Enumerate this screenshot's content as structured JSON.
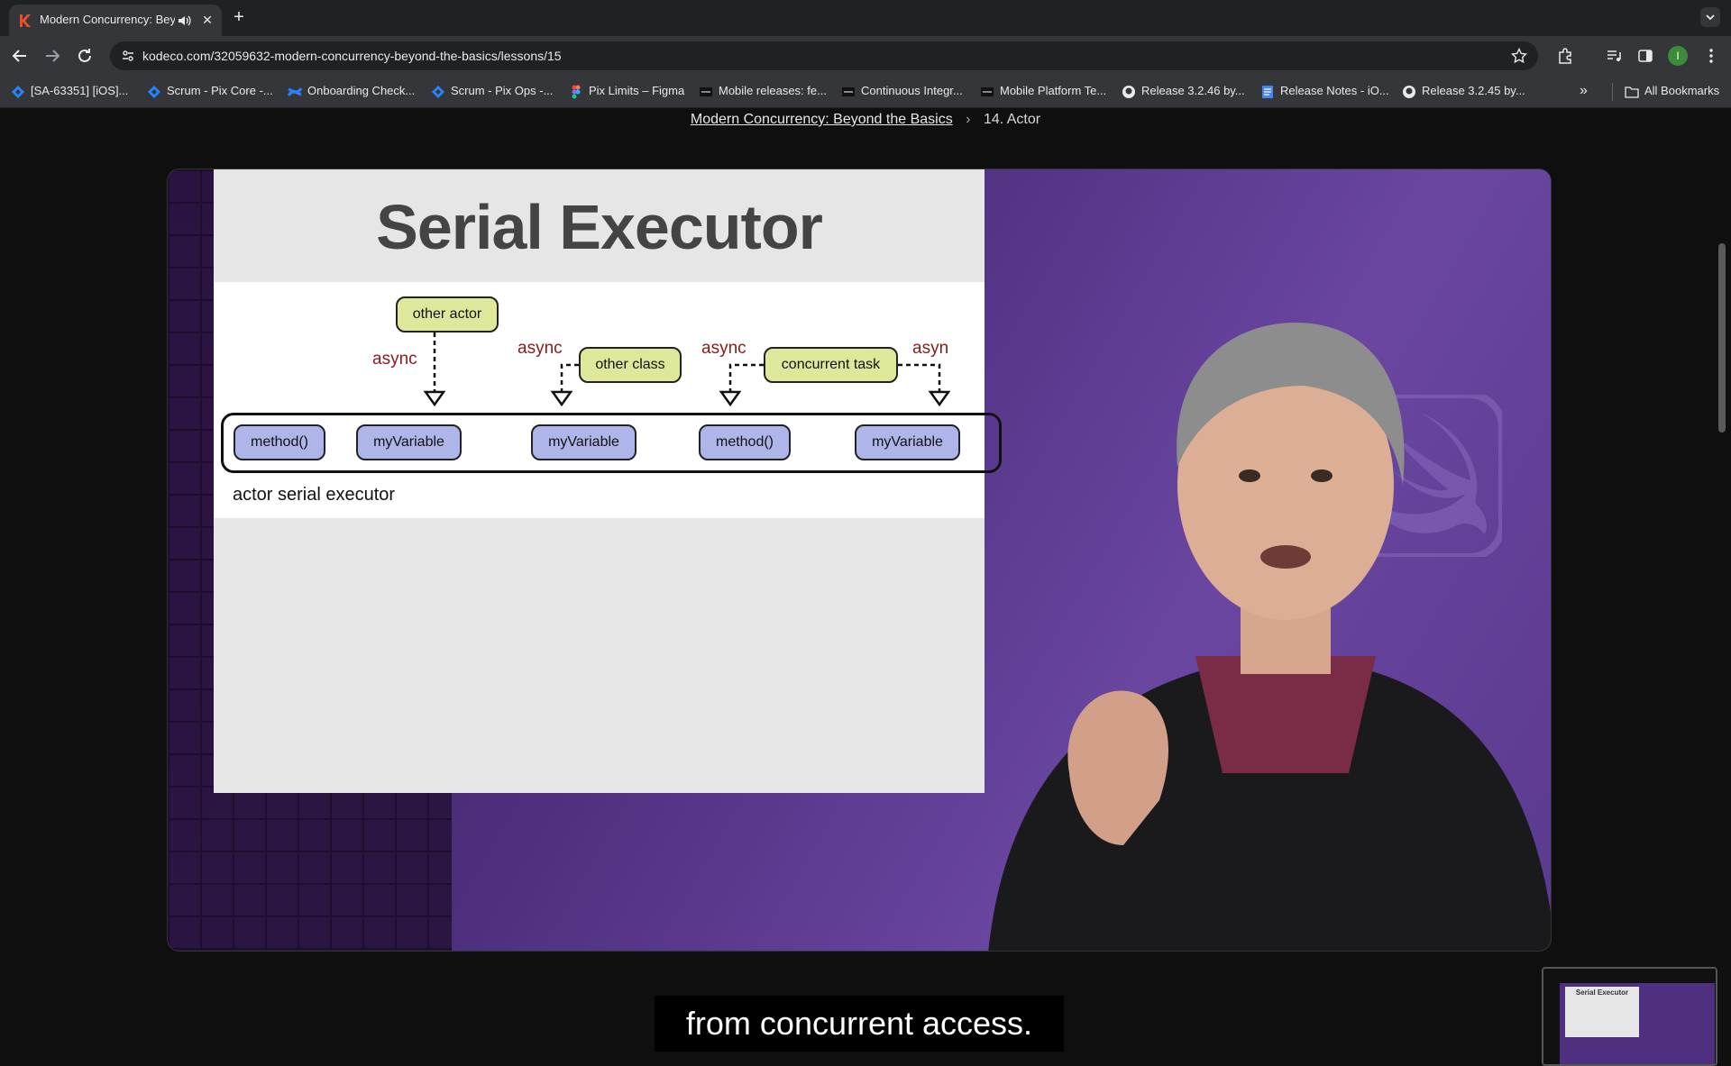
{
  "browser": {
    "tab": {
      "title": "Modern Concurrency: Beyond the Basics",
      "favicon": "kodeco-k-icon"
    },
    "url": "kodeco.com/32059632-modern-concurrency-beyond-the-basics/lessons/15",
    "profile_initial": "I",
    "bookmarks": [
      {
        "label": "[SA-63351] [iOS]...",
        "icon": "jira-icon"
      },
      {
        "label": "Scrum - Pix Core -...",
        "icon": "jira-icon"
      },
      {
        "label": "Onboarding Check...",
        "icon": "confluence-icon"
      },
      {
        "label": "Scrum - Pix Ops -...",
        "icon": "jira-icon"
      },
      {
        "label": "Pix Limits – Figma",
        "icon": "figma-icon"
      },
      {
        "label": "Mobile releases: fe...",
        "icon": "site-icon"
      },
      {
        "label": "Continuous Integr...",
        "icon": "site-icon"
      },
      {
        "label": "Mobile Platform Te...",
        "icon": "site-icon"
      },
      {
        "label": "Release 3.2.46 by...",
        "icon": "github-icon"
      },
      {
        "label": "Release Notes - iO...",
        "icon": "docs-icon"
      },
      {
        "label": "Release 3.2.45 by...",
        "icon": "github-icon"
      }
    ],
    "all_bookmarks": "All Bookmarks"
  },
  "breadcrumb": {
    "course": "Modern Concurrency: Beyond the Basics",
    "separator": "›",
    "lesson": "14. Actor"
  },
  "slide": {
    "title": "Serial Executor",
    "callers": [
      "other actor",
      "other class",
      "concurrent task"
    ],
    "async_labels": [
      "async",
      "async",
      "async",
      "asyn"
    ],
    "members": [
      "method()",
      "myVariable",
      "myVariable",
      "method()",
      "myVariable"
    ],
    "executor_label": "actor serial executor"
  },
  "caption": "from concurrent access.",
  "pip": {
    "slide_title": "Serial Executor"
  },
  "colors": {
    "video_purple": "#4e2f7e",
    "pill_blue": "#aeb5e8",
    "pill_yellow": "#dfe89a",
    "async_red": "#8b1a1a"
  }
}
